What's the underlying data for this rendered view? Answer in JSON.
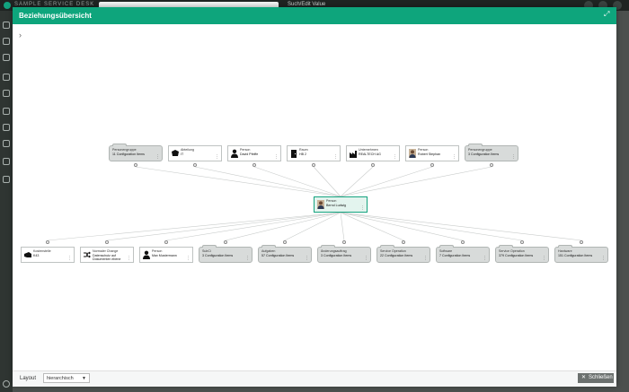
{
  "appbar": {
    "brand": "SAMPLE SERVICE DESK",
    "search_placeholder": "Such/Edit Value"
  },
  "modal": {
    "title": "Beziehungsübersicht",
    "expand_icon": "expand-icon",
    "collapse_chevron": "›"
  },
  "colors": {
    "accent": "#0ea57c",
    "center_fill": "#e3f4ee",
    "group_fill": "#d8dbda"
  },
  "center_node": {
    "type": "Person",
    "name": "Bernd Ludwig",
    "icon": "person-photo-icon"
  },
  "top_nodes": [
    {
      "type": "Personengruppe",
      "name": "11 Configuration Items",
      "group": true,
      "icon": ""
    },
    {
      "type": "Abteilung",
      "name": "IT",
      "group": false,
      "icon": "department-icon"
    },
    {
      "type": "Person",
      "name": "David Pfeiffe",
      "group": false,
      "icon": "person-icon"
    },
    {
      "type": "Raum",
      "name": "HB 2",
      "group": false,
      "icon": "room-icon"
    },
    {
      "type": "Unternehmen",
      "name": "REALTECH AG",
      "group": false,
      "icon": "company-icon"
    },
    {
      "type": "Person",
      "name": "Robert Stephan",
      "group": false,
      "icon": "person-photo-icon"
    },
    {
      "type": "Personengruppe",
      "name": "3 Configuration Items",
      "group": true,
      "icon": ""
    }
  ],
  "bottom_nodes": [
    {
      "type": "Kostenstelle",
      "name": "K43",
      "group": false,
      "icon": "cost-center-icon"
    },
    {
      "type": "Normaler Change",
      "name": "Datenschutz auf Dokumenten ebene",
      "group": false,
      "icon": "change-icon"
    },
    {
      "type": "Person",
      "name": "Max Mustermann",
      "group": false,
      "icon": "person-icon"
    },
    {
      "type": "SubCi",
      "name": "3 Configuration Items",
      "group": true,
      "icon": ""
    },
    {
      "type": "Aufgaben",
      "name": "57 Configuration Items",
      "group": true,
      "icon": ""
    },
    {
      "type": "Änderungsauftrag",
      "name": "3 Configuration Items",
      "group": true,
      "icon": ""
    },
    {
      "type": "Service Operation",
      "name": "22 Configuration Items",
      "group": true,
      "icon": ""
    },
    {
      "type": "Software",
      "name": "7 Configuration Items",
      "group": true,
      "icon": ""
    },
    {
      "type": "Service Operation",
      "name": "379 Configuration Items",
      "group": true,
      "icon": ""
    },
    {
      "type": "Hardware",
      "name": "151 Configuration Items",
      "group": true,
      "icon": ""
    }
  ],
  "footer": {
    "layout_label": "Layout",
    "layout_value": "hierarchisch",
    "close_label": "Schließen"
  }
}
